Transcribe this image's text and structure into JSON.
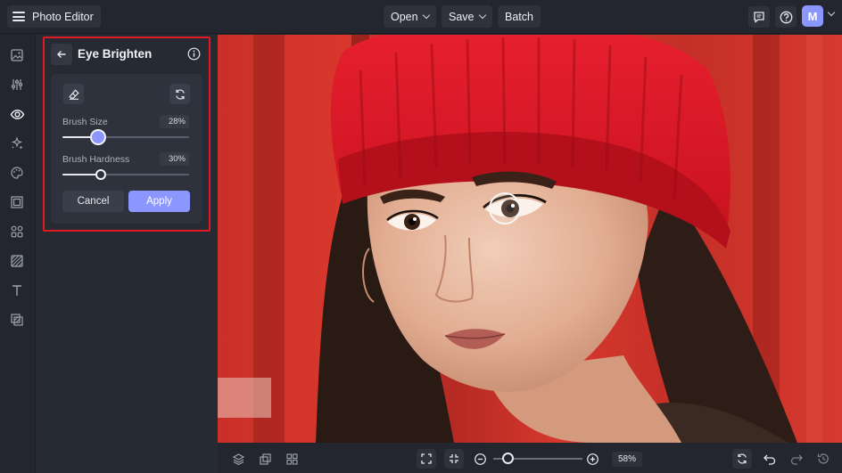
{
  "header": {
    "app_title": "Photo Editor",
    "open_label": "Open",
    "save_label": "Save",
    "batch_label": "Batch",
    "avatar_initial": "M"
  },
  "rail": {
    "items": [
      "image-icon",
      "adjust-sliders-icon",
      "eye-icon",
      "effects-sparkle-icon",
      "palette-icon",
      "frame-icon",
      "graphics-icon",
      "texture-icon",
      "text-icon",
      "overlay-icon"
    ],
    "active": "eye-icon"
  },
  "panel": {
    "title": "Eye Brighten",
    "brush_size": {
      "label": "Brush Size",
      "value_text": "28%",
      "value": 0.28
    },
    "brush_hardness": {
      "label": "Brush Hardness",
      "value_text": "30%",
      "value": 0.3
    },
    "cancel_label": "Cancel",
    "apply_label": "Apply"
  },
  "footer": {
    "zoom_text": "58%",
    "zoom_value": 0.58
  },
  "colors": {
    "accent": "#8b97ff",
    "highlight": "#e11a22",
    "background": "#23262f",
    "panel": "#262a33"
  }
}
